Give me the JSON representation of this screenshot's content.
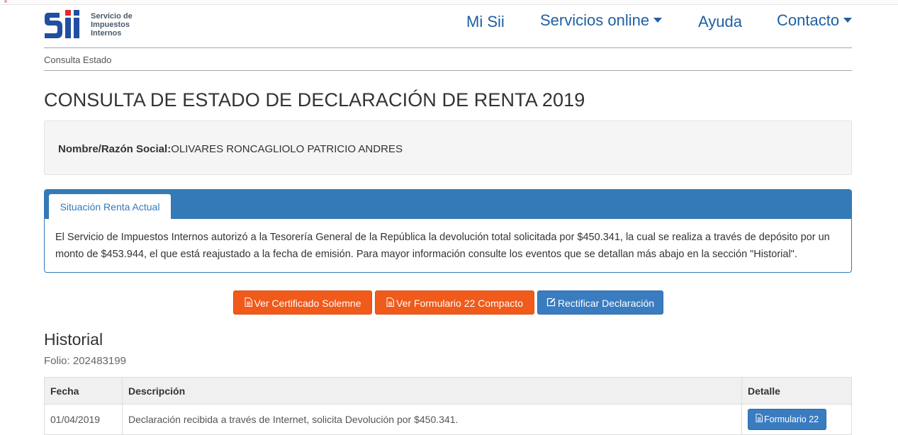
{
  "logo": {
    "mark": "Sii",
    "line1": "Servicio de",
    "line2": "Impuestos",
    "line3": "Internos"
  },
  "nav": {
    "mi_sii": "Mi Sii",
    "servicios": "Servicios online",
    "ayuda": "Ayuda",
    "contacto": "Contacto"
  },
  "breadcrumb": "Consulta Estado",
  "page_title": "CONSULTA DE ESTADO DE DECLARACIÓN DE RENTA 2019",
  "contribuyente": {
    "label": "Nombre/Razón Social:",
    "value": "OLIVARES RONCAGLIOLO PATRICIO ANDRES"
  },
  "panel": {
    "tab_label": "Situación Renta Actual",
    "body": "El Servicio de Impuestos Internos autorizó a la Tesorería General de la República la devolución total solicitada por $450.341, la cual se realiza a través de depósito por un monto de $453.944, el que está reajustado a la fecha de emisión. Para mayor información consulte los eventos que se detallan más abajo en la sección \"Historial\"."
  },
  "actions": {
    "certificado": "Ver Certificado Solemne",
    "formulario": "Ver Formulario 22 Compacto",
    "rectificar": "Rectificar Declaración"
  },
  "historial": {
    "title": "Historial",
    "folio": "Folio: 202483199",
    "headers": {
      "fecha": "Fecha",
      "descripcion": "Descripción",
      "detalle": "Detalle"
    },
    "rows": [
      {
        "fecha": "01/04/2019",
        "descripcion": "Declaración recibida a través de Internet, solicita Devolución por $450.341.",
        "detalle": "Formulario 22"
      }
    ]
  },
  "colors": {
    "brand_blue": "#337ab7",
    "action_orange": "#f05a1a",
    "nav_link": "#1f5fa3"
  },
  "icons": {
    "file": "file-icon",
    "edit": "edit-icon",
    "caret": "caret-down-icon"
  }
}
